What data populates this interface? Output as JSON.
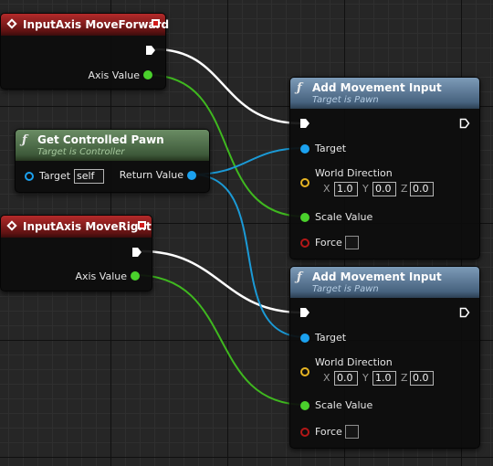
{
  "nodes": {
    "forward": {
      "title": "InputAxis MoveForward",
      "axis_label": "Axis Value"
    },
    "right": {
      "title": "InputAxis MoveRight",
      "axis_label": "Axis Value"
    },
    "pawn": {
      "title": "Get Controlled Pawn",
      "subtitle": "Target is Controller",
      "target_label": "Target",
      "target_value": "self",
      "return_label": "Return Value"
    },
    "move1": {
      "title": "Add Movement Input",
      "subtitle": "Target is Pawn",
      "target_label": "Target",
      "direction_label": "World Direction",
      "x_label": "X",
      "y_label": "Y",
      "z_label": "Z",
      "x_value": "1.0",
      "y_value": "0.0",
      "z_value": "0.0",
      "scale_label": "Scale Value",
      "force_label": "Force",
      "force_checked": false
    },
    "move2": {
      "title": "Add Movement Input",
      "subtitle": "Target is Pawn",
      "target_label": "Target",
      "direction_label": "World Direction",
      "x_label": "X",
      "y_label": "Y",
      "z_label": "Z",
      "x_value": "0.0",
      "y_value": "1.0",
      "z_value": "0.0",
      "scale_label": "Scale Value",
      "force_label": "Force",
      "force_checked": false
    }
  },
  "colors": {
    "exec_wire": "#ffffff",
    "float_wire": "#3fb81f",
    "object_wire": "#1b9ad6",
    "event_header": "#8e1f1f",
    "pure_header": "#4f6f49",
    "function_header": "#5c7c9c"
  }
}
